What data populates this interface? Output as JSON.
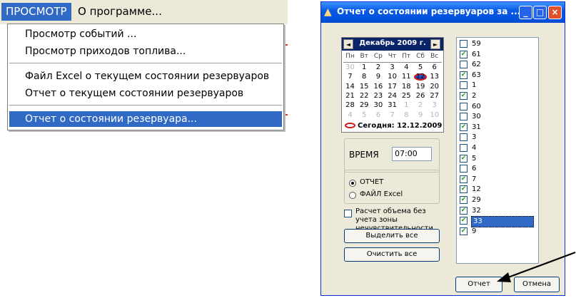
{
  "menubar": {
    "view": "ПРОСМОТР",
    "about": "О программе..."
  },
  "dropdown": {
    "items": [
      "Просмотр событий ...",
      "Просмотр приходов топлива...",
      "Файл Excel о текущем состоянии резервуаров",
      "Отчет о текущем состоянии резервуаров",
      "Отчет  о состоянии резервуара..."
    ],
    "selected_index": 4
  },
  "dialog": {
    "title": "Отчет о состоянии резервуаров за ...",
    "titlebar_buttons": {
      "minimize": "_",
      "maximize": "□",
      "close": "×"
    }
  },
  "calendar": {
    "month": "Декабрь 2009 г.",
    "prev": "◄",
    "next": "►",
    "weekdays": [
      "Пн",
      "Вт",
      "Ср",
      "Чт",
      "Пт",
      "Сб",
      "Вс"
    ],
    "weeks": [
      [
        {
          "d": "30",
          "o": true
        },
        {
          "d": "1"
        },
        {
          "d": "2"
        },
        {
          "d": "3"
        },
        {
          "d": "4"
        },
        {
          "d": "5"
        },
        {
          "d": "6"
        }
      ],
      [
        {
          "d": "7"
        },
        {
          "d": "8"
        },
        {
          "d": "9"
        },
        {
          "d": "10"
        },
        {
          "d": "11"
        },
        {
          "d": "12"
        },
        {
          "d": "13"
        }
      ],
      [
        {
          "d": "14"
        },
        {
          "d": "15"
        },
        {
          "d": "16"
        },
        {
          "d": "17"
        },
        {
          "d": "18"
        },
        {
          "d": "19"
        },
        {
          "d": "20"
        }
      ],
      [
        {
          "d": "21"
        },
        {
          "d": "22"
        },
        {
          "d": "23"
        },
        {
          "d": "24"
        },
        {
          "d": "25"
        },
        {
          "d": "26"
        },
        {
          "d": "27"
        }
      ],
      [
        {
          "d": "28"
        },
        {
          "d": "29"
        },
        {
          "d": "30"
        },
        {
          "d": "31"
        },
        {
          "d": "1",
          "o": true
        },
        {
          "d": "2",
          "o": true
        },
        {
          "d": "3",
          "o": true
        }
      ],
      [
        {
          "d": "4",
          "o": true
        },
        {
          "d": "5",
          "o": true
        },
        {
          "d": "6",
          "o": true
        },
        {
          "d": "7",
          "o": true
        },
        {
          "d": "8",
          "o": true
        },
        {
          "d": "9",
          "o": true
        },
        {
          "d": "10",
          "o": true
        }
      ]
    ],
    "selected_day": "12",
    "today_label": "Сегодня: 12.12.2009"
  },
  "time": {
    "label": "ВРЕМЯ",
    "value": "07:00"
  },
  "output": {
    "report_label": "ОТЧЕТ",
    "excel_label": "ФАЙЛ Excel",
    "selected": "report"
  },
  "volume_option": {
    "label": "Расчет объема без учета зоны нечувствительности",
    "checked": false
  },
  "buttons": {
    "select_all": "Выделить все",
    "clear_all": "Очистить все",
    "ok": "Отчет",
    "cancel": "Отмена"
  },
  "tanks": [
    {
      "name": "59",
      "checked": false
    },
    {
      "name": "61",
      "checked": true
    },
    {
      "name": "62",
      "checked": false
    },
    {
      "name": "63",
      "checked": true
    },
    {
      "name": "1",
      "checked": false
    },
    {
      "name": "2",
      "checked": true
    },
    {
      "name": "60",
      "checked": false
    },
    {
      "name": "30",
      "checked": false
    },
    {
      "name": "31",
      "checked": true
    },
    {
      "name": "3",
      "checked": false
    },
    {
      "name": "4",
      "checked": false
    },
    {
      "name": "5",
      "checked": true
    },
    {
      "name": "6",
      "checked": false
    },
    {
      "name": "7",
      "checked": true
    },
    {
      "name": "12",
      "checked": true
    },
    {
      "name": "29",
      "checked": true
    },
    {
      "name": "32",
      "checked": true
    },
    {
      "name": "33",
      "checked": true,
      "selected": true
    },
    {
      "name": "9",
      "checked": true
    }
  ],
  "colors": {
    "selection": "#316ac5",
    "titlebar": "#0a5ae6",
    "calendar_header": "#0a246a",
    "today_mark": "#d01818"
  }
}
